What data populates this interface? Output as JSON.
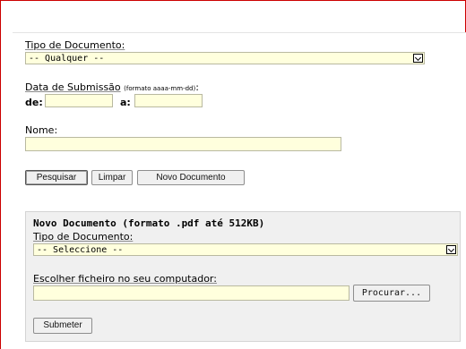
{
  "search": {
    "doc_type_label": "Tipo de Documento:",
    "doc_type_value": "-- Qualquer --",
    "date_label": "Data de Submissão",
    "date_format_note": "(formato aaaa-mm-dd)",
    "date_colon": ":",
    "from_label": "de:",
    "from_value": "",
    "to_label": "a:",
    "to_value": "",
    "name_label": "Nome:",
    "name_value": ""
  },
  "buttons": {
    "search": "Pesquisar",
    "clear": "Limpar",
    "new_document": "Novo Documento"
  },
  "new_document_panel": {
    "title": "Novo Documento (formato .pdf até 512KB)",
    "doc_type_label": "Tipo de Documento:",
    "doc_type_value": "-- Seleccione --",
    "file_label": "Escolher ficheiro no seu computador:",
    "file_value": "",
    "browse_label": "Procurar...",
    "submit_label": "Submeter"
  },
  "icons": {
    "select_arrow": "chevron-down-icon"
  },
  "colors": {
    "frame_border": "#cc0000",
    "field_background": "#ffffdd",
    "panel_background": "#f0f0f0"
  }
}
